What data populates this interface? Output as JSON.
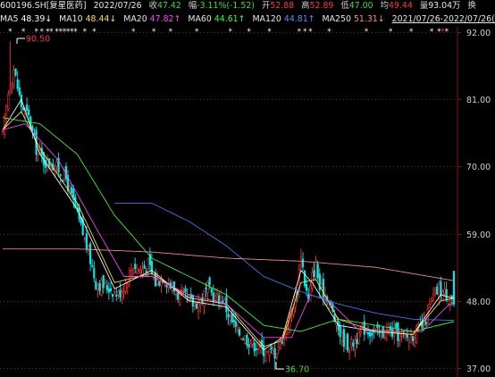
{
  "header": {
    "symbol": "600196.SH[复星医药]",
    "date": "2022/07/26",
    "close_label": "收",
    "close": "47.42",
    "change_label": "幅",
    "change": "-3.11%(-1.52)",
    "open_label": "开",
    "open": "52.88",
    "high_label": "高",
    "high": "52.89",
    "low_label": "低",
    "low": "47.00",
    "avg_label": "均",
    "avg": "49.44",
    "vol_label": "量",
    "vol": "93.04万",
    "turnover_label": "换"
  },
  "ma_bar": {
    "ma5_label": "MA5",
    "ma5": "48.39↓",
    "ma10_label": "MA10",
    "ma10": "48.44↓",
    "ma20_label": "MA20",
    "ma20": "47.82↑",
    "ma60_label": "MA60",
    "ma60": "44.61↑",
    "ma120_label": "MA120",
    "ma120": "44.81↑",
    "ma250_label": "MA250",
    "ma250": "51.31↓",
    "range": "2021/07/26-2022/07/26(243日)"
  },
  "y_axis": {
    "ticks": [
      "92.00",
      "81.00",
      "70.00",
      "59.00",
      "48.00",
      "37.00"
    ]
  },
  "annotations": {
    "high_mark": "90.50",
    "low_mark": "36.70"
  },
  "colors": {
    "up": "#ff3232",
    "down": "#00e8e8",
    "ma5": "#ffffff",
    "ma10": "#ffe14a",
    "ma20": "#ff44ff",
    "ma60": "#3aff3a",
    "ma120": "#3c7dff",
    "ma250": "#ff8a8a",
    "grid": "#7a1a1a",
    "label_red": "#ff3a3a",
    "label_green": "#36e036"
  },
  "chart_data": {
    "type": "candlestick",
    "period": "2021/07/26-2022/07/26",
    "bars": 243,
    "ylim": [
      37.0,
      92.0
    ],
    "yticks": [
      92.0,
      81.0,
      70.0,
      59.0,
      48.0,
      37.0
    ],
    "max_high": 90.5,
    "min_low": 36.7,
    "last_bar": {
      "open": 52.88,
      "high": 52.89,
      "low": 47.0,
      "close": 47.42
    },
    "close_path": [
      [
        0,
        75
      ],
      [
        3,
        82
      ],
      [
        6,
        86
      ],
      [
        10,
        80
      ],
      [
        14,
        78
      ],
      [
        18,
        73
      ],
      [
        22,
        71
      ],
      [
        26,
        70.5
      ],
      [
        30,
        69.5
      ],
      [
        34,
        68
      ],
      [
        38,
        64
      ],
      [
        42,
        60
      ],
      [
        46,
        56
      ],
      [
        50,
        51
      ],
      [
        54,
        50.5
      ],
      [
        58,
        50
      ],
      [
        62,
        49
      ],
      [
        66,
        51
      ],
      [
        70,
        54
      ],
      [
        74,
        53
      ],
      [
        78,
        54
      ],
      [
        82,
        51
      ],
      [
        86,
        52
      ],
      [
        90,
        50.5
      ],
      [
        94,
        49
      ],
      [
        98,
        48.5
      ],
      [
        102,
        47.5
      ],
      [
        106,
        48
      ],
      [
        110,
        50
      ],
      [
        114,
        48.5
      ],
      [
        118,
        48.5
      ],
      [
        122,
        45
      ],
      [
        126,
        43
      ],
      [
        130,
        42
      ],
      [
        134,
        41
      ],
      [
        138,
        40.5
      ],
      [
        142,
        39.5
      ],
      [
        146,
        39.5
      ],
      [
        150,
        42
      ],
      [
        154,
        45
      ],
      [
        158,
        50
      ],
      [
        160,
        56
      ],
      [
        162,
        51
      ],
      [
        164,
        48
      ],
      [
        166,
        52
      ],
      [
        168,
        54
      ],
      [
        170,
        50
      ],
      [
        174,
        49
      ],
      [
        178,
        45
      ],
      [
        182,
        42
      ],
      [
        186,
        40.5
      ],
      [
        190,
        42
      ],
      [
        194,
        43.5
      ],
      [
        198,
        43
      ],
      [
        202,
        42.5
      ],
      [
        206,
        43
      ],
      [
        210,
        42.8
      ],
      [
        214,
        42
      ],
      [
        218,
        42
      ],
      [
        222,
        43
      ],
      [
        226,
        44
      ],
      [
        230,
        48
      ],
      [
        234,
        50
      ],
      [
        238,
        49
      ],
      [
        240,
        49.4
      ],
      [
        242,
        47.42
      ]
    ],
    "ma_series": [
      {
        "name": "MA5",
        "values": [
          [
            0,
            76
          ],
          [
            10,
            81
          ],
          [
            20,
            72
          ],
          [
            40,
            63
          ],
          [
            60,
            50
          ],
          [
            80,
            53
          ],
          [
            100,
            48
          ],
          [
            120,
            47
          ],
          [
            140,
            40
          ],
          [
            150,
            42
          ],
          [
            160,
            53
          ],
          [
            166,
            51
          ],
          [
            180,
            44
          ],
          [
            200,
            43
          ],
          [
            220,
            42.5
          ],
          [
            235,
            49
          ],
          [
            242,
            48.39
          ]
        ]
      },
      {
        "name": "MA10",
        "values": [
          [
            0,
            76
          ],
          [
            10,
            79
          ],
          [
            20,
            73
          ],
          [
            40,
            64
          ],
          [
            60,
            51
          ],
          [
            80,
            52.5
          ],
          [
            100,
            48.5
          ],
          [
            120,
            47.5
          ],
          [
            140,
            40.5
          ],
          [
            150,
            41.5
          ],
          [
            160,
            51
          ],
          [
            168,
            51.5
          ],
          [
            180,
            45
          ],
          [
            200,
            43
          ],
          [
            220,
            42.5
          ],
          [
            235,
            48
          ],
          [
            242,
            48.44
          ]
        ]
      },
      {
        "name": "MA20",
        "values": [
          [
            0,
            76
          ],
          [
            12,
            77
          ],
          [
            30,
            71
          ],
          [
            50,
            60
          ],
          [
            65,
            52
          ],
          [
            80,
            52
          ],
          [
            100,
            49
          ],
          [
            120,
            47.5
          ],
          [
            140,
            42
          ],
          [
            155,
            42
          ],
          [
            165,
            49
          ],
          [
            175,
            48
          ],
          [
            190,
            43.5
          ],
          [
            210,
            43
          ],
          [
            225,
            43
          ],
          [
            238,
            47
          ],
          [
            242,
            47.82
          ]
        ]
      },
      {
        "name": "MA60",
        "values": [
          [
            0,
            78
          ],
          [
            20,
            77
          ],
          [
            40,
            72
          ],
          [
            60,
            62
          ],
          [
            80,
            55
          ],
          [
            100,
            52
          ],
          [
            120,
            49
          ],
          [
            140,
            44
          ],
          [
            160,
            43
          ],
          [
            180,
            45
          ],
          [
            200,
            44
          ],
          [
            220,
            43
          ],
          [
            242,
            44.61
          ]
        ]
      },
      {
        "name": "MA120",
        "values": [
          [
            60,
            64
          ],
          [
            80,
            64
          ],
          [
            100,
            61
          ],
          [
            120,
            57
          ],
          [
            140,
            52
          ],
          [
            160,
            49.5
          ],
          [
            180,
            47.5
          ],
          [
            200,
            46
          ],
          [
            220,
            45
          ],
          [
            242,
            44.81
          ]
        ]
      },
      {
        "name": "MA250",
        "values": [
          [
            0,
            56.5
          ],
          [
            40,
            56.5
          ],
          [
            80,
            56
          ],
          [
            120,
            55
          ],
          [
            160,
            54.5
          ],
          [
            200,
            53.5
          ],
          [
            242,
            51.31
          ]
        ]
      }
    ],
    "event_marks": {
      "white_star_bars": [
        4,
        11,
        18,
        21,
        24,
        26,
        29,
        31,
        33,
        35,
        37,
        39,
        44,
        49,
        70,
        81,
        90,
        104,
        122,
        132,
        143,
        159,
        162,
        165,
        175,
        195,
        208,
        219,
        230,
        234,
        238
      ],
      "red_star_bars": [
        236
      ]
    }
  }
}
